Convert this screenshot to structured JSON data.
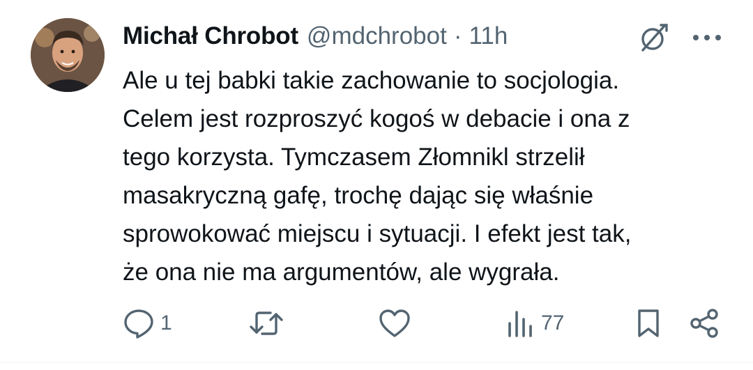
{
  "tweet": {
    "author": {
      "name": "Michał Chrobot",
      "handle": "@mdchrobot",
      "separator": "·",
      "time": "11h"
    },
    "text_lines": [
      "Ale u tej babki takie zachowanie to socjologia.",
      "Celem jest rozproszyć kogoś w debacie i ona z",
      "tego korzysta. Tymczasem Złomnikl strzelił",
      "masakryczną gafę, trochę dając się właśnie",
      "sprowokować miejscu i sytuacji. I efekt jest tak,",
      "że ona nie ma argumentów, ale wygrała."
    ],
    "actions": {
      "reply": {
        "icon": "reply-icon",
        "count": "1"
      },
      "retweet": {
        "icon": "retweet-icon",
        "count": ""
      },
      "like": {
        "icon": "heart-icon",
        "count": ""
      },
      "views": {
        "icon": "views-icon",
        "count": "77"
      },
      "bookmark": {
        "icon": "bookmark-icon",
        "count": ""
      },
      "share": {
        "icon": "share-icon",
        "count": ""
      }
    },
    "header_icons": {
      "grok": "grok-icon",
      "more": "more-icon"
    }
  },
  "colors": {
    "text_primary": "#0f1419",
    "text_secondary": "#536471",
    "background": "#ffffff"
  }
}
